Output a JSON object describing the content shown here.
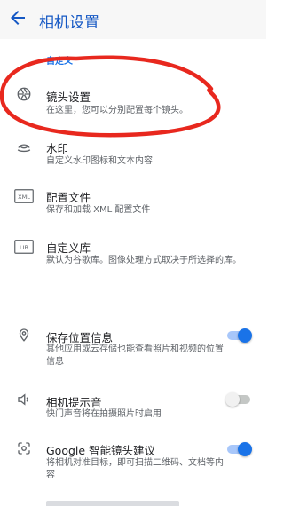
{
  "appbar": {
    "title": "相机设置",
    "back_icon": "arrow-back-icon"
  },
  "section": {
    "header": "自定义"
  },
  "items": [
    {
      "title": "镜头设置",
      "subtitle": "在这里，您可以分别配置每个镜头。",
      "icon": "aperture-icon"
    },
    {
      "title": "水印",
      "subtitle": "自定义水印图标和文本内容",
      "icon": "watermark-icon"
    },
    {
      "title": "配置文件",
      "subtitle": "保存和加载 XML 配置文件",
      "icon": "xml-file-icon"
    },
    {
      "title": "自定义库",
      "subtitle": "默认为谷歌库。图像处理方式取决于所选择的库。",
      "icon": "lib-icon"
    }
  ],
  "toggles": [
    {
      "title": "保存位置信息",
      "subtitle": "其他应用或云存储也能查看照片和视频的位置信息",
      "icon": "location-pin-icon",
      "on": true
    },
    {
      "title": "相机提示音",
      "subtitle": "快门声音将在拍摄照片时启用",
      "icon": "volume-icon",
      "on": false
    },
    {
      "title": "Google 智能镜头建议",
      "subtitle": "将相机对准目标，即可扫描二维码、文档等内容",
      "icon": "google-lens-icon",
      "on": true
    }
  ],
  "colors": {
    "accent": "#1a73e8",
    "annotation": "#e8281e"
  }
}
